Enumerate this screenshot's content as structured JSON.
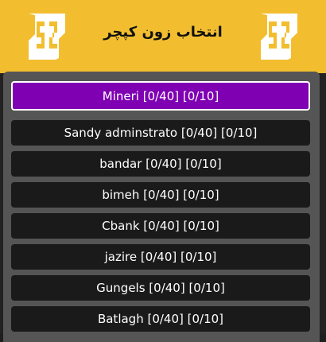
{
  "header": {
    "title": "انتخاب زون کپچر",
    "logo_icon": "s2-logo-icon",
    "background": "#f2be2f"
  },
  "zones": [
    {
      "label": "Mineri [0/40] [0/10]",
      "selected": true
    },
    {
      "label": "Sandy adminstrato [0/40] [0/10]",
      "selected": false
    },
    {
      "label": "bandar [0/40] [0/10]",
      "selected": false
    },
    {
      "label": "bimeh [0/40] [0/10]",
      "selected": false
    },
    {
      "label": "Cbank [0/40] [0/10]",
      "selected": false
    },
    {
      "label": "jazire [0/40] [0/10]",
      "selected": false
    },
    {
      "label": "Gungels [0/40] [0/10]",
      "selected": false
    },
    {
      "label": "Batlagh [0/40] [0/10]",
      "selected": false
    }
  ],
  "colors": {
    "selected": "#7f00b2",
    "item": "#1a1a1a",
    "panel": "#555555"
  }
}
